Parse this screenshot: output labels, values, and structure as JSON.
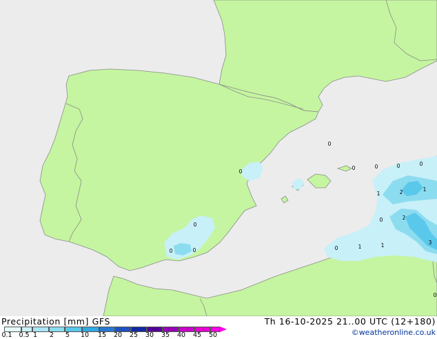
{
  "legend": {
    "title": "Precipitation [mm]",
    "model": "GFS",
    "valid_time": "Th 16-10-2025 21..00 UTC (12+180)",
    "credit": "©weatheronline.co.uk",
    "scale": [
      "0.1",
      "0.5",
      "1",
      "2",
      "5",
      "10",
      "15",
      "20",
      "25",
      "30",
      "35",
      "40",
      "45",
      "50"
    ],
    "colors": [
      "#e6fafa",
      "#c8f0f8",
      "#aae6f5",
      "#8cdcf0",
      "#5ac8eb",
      "#32a8e0",
      "#2878d2",
      "#1e50c0",
      "#1428a0",
      "#500096",
      "#9600b4",
      "#c800c8",
      "#e600d2",
      "#fa00e6"
    ]
  },
  "map": {
    "colors": {
      "sea": "#ececec",
      "land": "#c5f5a0",
      "border": "#8a8a8a",
      "rain_light": "#c8f0f8",
      "rain_med": "#8cdcf0",
      "rain_strong": "#5ac8eb"
    },
    "labels": [
      {
        "id": "l1",
        "text": "0"
      },
      {
        "id": "l2",
        "text": "0"
      },
      {
        "id": "l3",
        "text": "0"
      },
      {
        "id": "l4",
        "text": "0"
      },
      {
        "id": "l5",
        "text": "0"
      },
      {
        "id": "l6",
        "text": "0"
      },
      {
        "id": "l7",
        "text": "1"
      },
      {
        "id": "l8",
        "text": "2"
      },
      {
        "id": "l9",
        "text": "1"
      },
      {
        "id": "l10",
        "text": "0"
      },
      {
        "id": "l11",
        "text": "2"
      },
      {
        "id": "l12",
        "text": "3"
      },
      {
        "id": "l13",
        "text": "0"
      },
      {
        "id": "l14",
        "text": "1"
      },
      {
        "id": "l15",
        "text": "1"
      },
      {
        "id": "l16",
        "text": "0"
      },
      {
        "id": "l17",
        "text": "0"
      },
      {
        "id": "l18",
        "text": "0"
      },
      {
        "id": "l19",
        "text": "0"
      }
    ]
  }
}
